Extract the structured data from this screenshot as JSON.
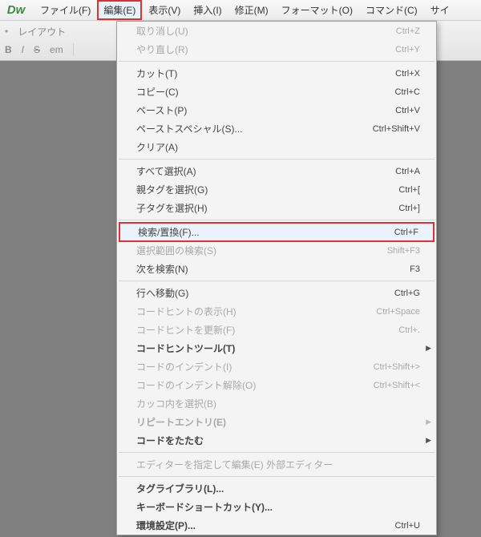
{
  "app_logo": "Dw",
  "menubar": [
    "ファイル(F)",
    "編集(E)",
    "表示(V)",
    "挿入(I)",
    "修正(M)",
    "フォーマット(O)",
    "コマンド(C)",
    "サイ"
  ],
  "active_menu_index": 1,
  "toolbar": {
    "row1": [
      "レイアウト"
    ],
    "row2_b": "B",
    "row2_i": "I",
    "row2_s": "S",
    "row2_em": "em"
  },
  "dropdown": [
    {
      "type": "item",
      "label": "取り消し(U)",
      "shortcut": "Ctrl+Z",
      "disabled": true
    },
    {
      "type": "item",
      "label": "やり直し(R)",
      "shortcut": "Ctrl+Y",
      "disabled": true
    },
    {
      "type": "sep"
    },
    {
      "type": "item",
      "label": "カット(T)",
      "shortcut": "Ctrl+X"
    },
    {
      "type": "item",
      "label": "コピー(C)",
      "shortcut": "Ctrl+C"
    },
    {
      "type": "item",
      "label": "ペースト(P)",
      "shortcut": "Ctrl+V"
    },
    {
      "type": "item",
      "label": "ペーストスペシャル(S)...",
      "shortcut": "Ctrl+Shift+V"
    },
    {
      "type": "item",
      "label": "クリア(A)",
      "shortcut": ""
    },
    {
      "type": "sep"
    },
    {
      "type": "item",
      "label": "すべて選択(A)",
      "shortcut": "Ctrl+A"
    },
    {
      "type": "item",
      "label": "親タグを選択(G)",
      "shortcut": "Ctrl+["
    },
    {
      "type": "item",
      "label": "子タグを選択(H)",
      "shortcut": "Ctrl+]"
    },
    {
      "type": "sep"
    },
    {
      "type": "item",
      "label": "検索/置換(F)...",
      "shortcut": "Ctrl+F",
      "highlighted": true
    },
    {
      "type": "item",
      "label": "選択範囲の検索(S)",
      "shortcut": "Shift+F3",
      "disabled": true
    },
    {
      "type": "item",
      "label": "次を検索(N)",
      "shortcut": "F3"
    },
    {
      "type": "sep"
    },
    {
      "type": "item",
      "label": "行へ移動(G)",
      "shortcut": "Ctrl+G"
    },
    {
      "type": "item",
      "label": "コードヒントの表示(H)",
      "shortcut": "Ctrl+Space",
      "disabled": true
    },
    {
      "type": "item",
      "label": "コードヒントを更新(F)",
      "shortcut": "Ctrl+.",
      "disabled": true
    },
    {
      "type": "item",
      "label": "コードヒントツール(T)",
      "shortcut": "",
      "submenu": true,
      "bold": true
    },
    {
      "type": "item",
      "label": "コードのインデント(I)",
      "shortcut": "Ctrl+Shift+>",
      "disabled": true
    },
    {
      "type": "item",
      "label": "コードのインデント解除(O)",
      "shortcut": "Ctrl+Shift+<",
      "disabled": true
    },
    {
      "type": "item",
      "label": "カッコ内を選択(B)",
      "shortcut": "",
      "disabled": true
    },
    {
      "type": "item",
      "label": "リピートエントリ(E)",
      "shortcut": "",
      "submenu": true,
      "bold": true,
      "disabled": true
    },
    {
      "type": "item",
      "label": "コードをたたむ",
      "shortcut": "",
      "submenu": true,
      "bold": true
    },
    {
      "type": "sep"
    },
    {
      "type": "item",
      "label": "エディターを指定して編集(E) 外部エディター",
      "shortcut": "",
      "disabled": true
    },
    {
      "type": "sep"
    },
    {
      "type": "item",
      "label": "タグライブラリ(L)...",
      "shortcut": "",
      "bold": true
    },
    {
      "type": "item",
      "label": "キーボードショートカット(Y)...",
      "shortcut": "",
      "bold": true
    },
    {
      "type": "item",
      "label": "環境設定(P)...",
      "shortcut": "Ctrl+U",
      "bold": true
    }
  ]
}
